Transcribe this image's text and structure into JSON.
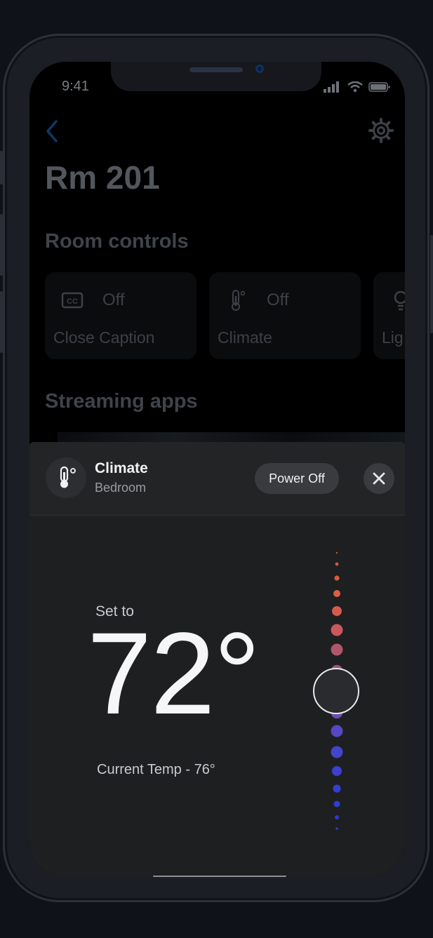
{
  "status_bar": {
    "time": "9:41"
  },
  "header": {
    "title": "Rm 201"
  },
  "sections": {
    "room_controls": "Room controls",
    "streaming_apps": "Streaming apps"
  },
  "room_controls": [
    {
      "icon": "closed-caption-icon",
      "state": "Off",
      "label": "Close Caption"
    },
    {
      "icon": "thermometer-icon",
      "state": "Off",
      "label": "Climate"
    },
    {
      "icon": "lightbulb-icon",
      "state": "",
      "label": "Lig"
    }
  ],
  "climate_sheet": {
    "title": "Climate",
    "subtitle": "Bedroom",
    "power_button": "Power Off",
    "set_to_label": "Set to",
    "set_temperature": "72°",
    "current_temperature": "Current Temp - 76°",
    "slider_level": 0.5
  },
  "colors": {
    "background": "#000000",
    "sheet": "#1e1f21",
    "accent_back": "#0b3a66",
    "warm_dot": "#e05a3a",
    "cool_dot": "#2a3bd6"
  }
}
